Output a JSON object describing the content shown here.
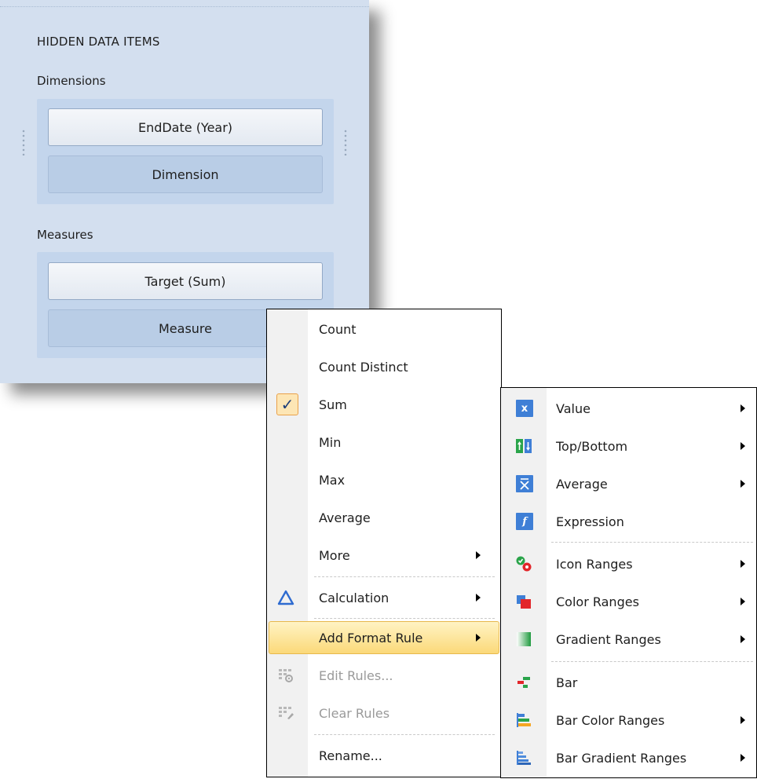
{
  "panel": {
    "title": "HIDDEN DATA ITEMS",
    "dimensions": {
      "label": "Dimensions",
      "item": "EndDate (Year)",
      "placeholder": "Dimension"
    },
    "measures": {
      "label": "Measures",
      "item": "Target (Sum)",
      "placeholder": "Measure"
    }
  },
  "context_menu": {
    "items": [
      {
        "label": "Count"
      },
      {
        "label": "Count Distinct"
      },
      {
        "label": "Sum",
        "checked": true
      },
      {
        "label": "Min"
      },
      {
        "label": "Max"
      },
      {
        "label": "Average"
      },
      {
        "label": "More",
        "submenu": true
      },
      {
        "label": "Calculation",
        "submenu": true,
        "icon": "delta-icon"
      },
      {
        "label": "Add Format Rule",
        "submenu": true,
        "highlighted": true
      },
      {
        "label": "Edit Rules...",
        "disabled": true,
        "icon": "edit-rules-icon"
      },
      {
        "label": "Clear Rules",
        "disabled": true,
        "icon": "clear-rules-icon"
      },
      {
        "label": "Rename..."
      }
    ]
  },
  "format_rule_menu": {
    "items": [
      {
        "label": "Value",
        "submenu": true,
        "icon": "value-icon"
      },
      {
        "label": "Top/Bottom",
        "submenu": true,
        "icon": "top-bottom-icon"
      },
      {
        "label": "Average",
        "submenu": true,
        "icon": "average-icon"
      },
      {
        "label": "Expression",
        "submenu": false,
        "icon": "expression-icon"
      },
      {
        "label": "Icon Ranges",
        "submenu": true,
        "icon": "icon-ranges-icon"
      },
      {
        "label": "Color Ranges",
        "submenu": true,
        "icon": "color-ranges-icon"
      },
      {
        "label": "Gradient Ranges",
        "submenu": true,
        "icon": "gradient-ranges-icon"
      },
      {
        "label": "Bar",
        "submenu": false,
        "icon": "bar-icon"
      },
      {
        "label": "Bar Color Ranges",
        "submenu": true,
        "icon": "bar-color-ranges-icon"
      },
      {
        "label": "Bar Gradient Ranges",
        "submenu": true,
        "icon": "bar-gradient-ranges-icon"
      }
    ]
  },
  "colors": {
    "panel_bg": "#d3dfef",
    "highlight": "#fbd979",
    "accent_blue": "#3f7fd6"
  }
}
